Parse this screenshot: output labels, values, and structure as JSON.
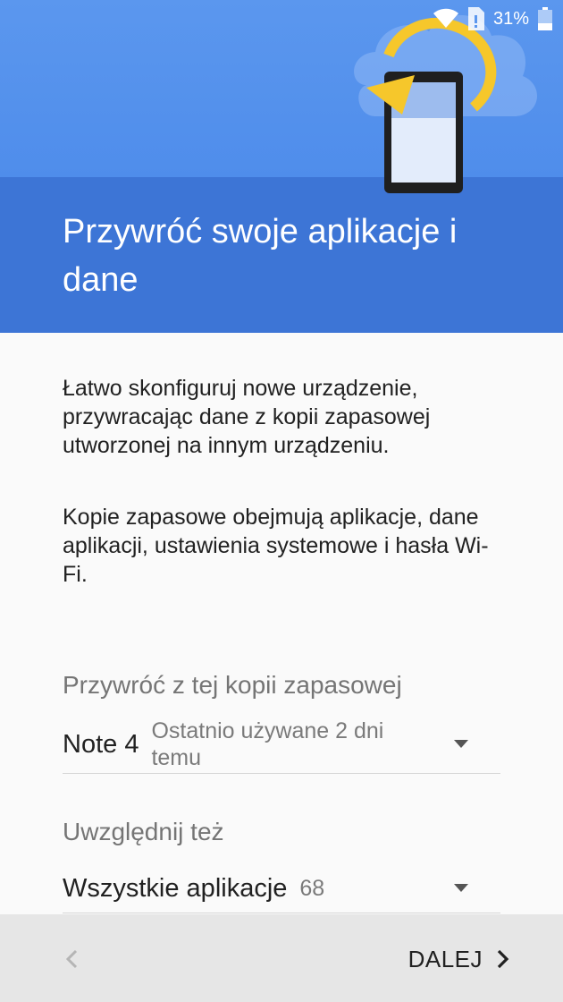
{
  "status_bar": {
    "battery_percent": "31%",
    "icons": [
      "wifi-icon",
      "sim-icon",
      "battery-icon"
    ]
  },
  "header": {
    "title": "Przywróć swoje aplikacje i dane",
    "illustration": "phone-restore-illustration",
    "colors": {
      "top": "#4f8deb",
      "band": "#3d75d6"
    }
  },
  "body": {
    "paragraph1": "Łatwo skonfiguruj nowe urządzenie, przywracając dane z kopii zapasowej utworzonej na innym urządzeniu.",
    "paragraph2": "Kopie zapasowe obejmują aplikacje, dane aplikacji, ustawienia systemowe i hasła Wi-Fi."
  },
  "backup_select": {
    "label": "Przywróć z tej kopii zapasowej",
    "device": "Note 4",
    "last_used": "Ostatnio używane 2 dni temu"
  },
  "include_select": {
    "label": "Uwzględnij też",
    "value": "Wszystkie aplikacje",
    "count": "68"
  },
  "footer": {
    "next_label": "DALEJ",
    "back_icon": "chevron-left-icon",
    "next_icon": "chevron-right-icon"
  }
}
